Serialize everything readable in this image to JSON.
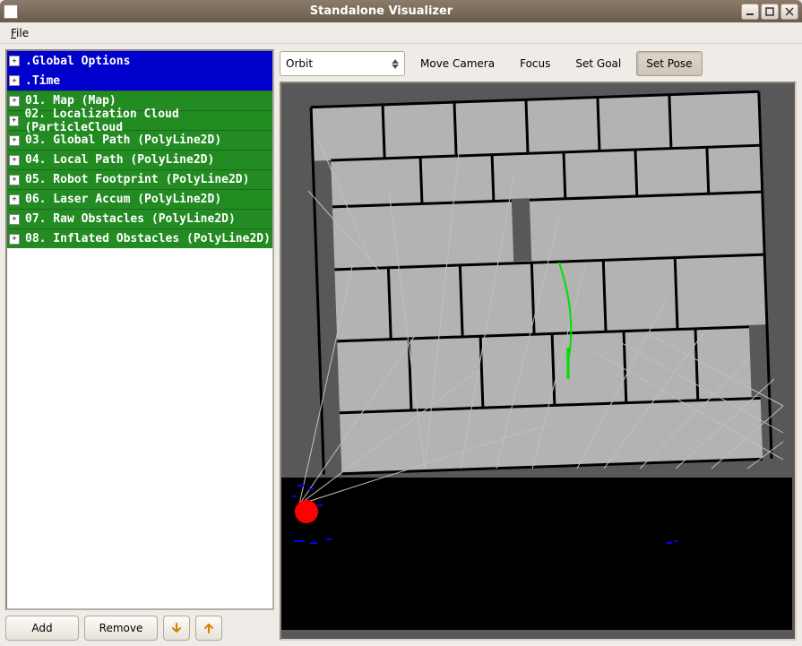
{
  "window": {
    "title": "Standalone Visualizer",
    "minimize_icon": "minimize-icon",
    "maximize_icon": "maximize-icon",
    "close_icon": "close-icon"
  },
  "menubar": {
    "file_prefix": "F",
    "file_rest": "ile"
  },
  "tree": {
    "items": [
      {
        "label": ".Global Options",
        "style": "blue"
      },
      {
        "label": ".Time",
        "style": "blue"
      },
      {
        "label": "01. Map (Map)",
        "style": "green"
      },
      {
        "label": "02. Localization Cloud (ParticleCloud",
        "style": "green"
      },
      {
        "label": "03. Global Path (PolyLine2D)",
        "style": "green"
      },
      {
        "label": "04. Local Path (PolyLine2D)",
        "style": "green"
      },
      {
        "label": "05. Robot Footprint (PolyLine2D)",
        "style": "green"
      },
      {
        "label": "06. Laser Accum (PolyLine2D)",
        "style": "green"
      },
      {
        "label": "07. Raw Obstacles (PolyLine2D)",
        "style": "green"
      },
      {
        "label": "08. Inflated Obstacles (PolyLine2D)",
        "style": "green"
      }
    ]
  },
  "buttons": {
    "add": "Add",
    "remove": "Remove"
  },
  "toolbar": {
    "camera_mode": "Orbit",
    "move_camera": "Move Camera",
    "focus": "Focus",
    "set_goal": "Set Goal",
    "set_pose": "Set Pose"
  },
  "colors": {
    "tree_option_bg": "#0000cd",
    "tree_layer_bg": "#228b22",
    "viewport_bg": "#585858",
    "map_free": "#b3b3b3",
    "map_wall": "#000000",
    "robot_marker": "#ff0000",
    "path_marker": "#00e000",
    "particle_marker": "#0000ff",
    "window_chrome": "#efebe7"
  }
}
